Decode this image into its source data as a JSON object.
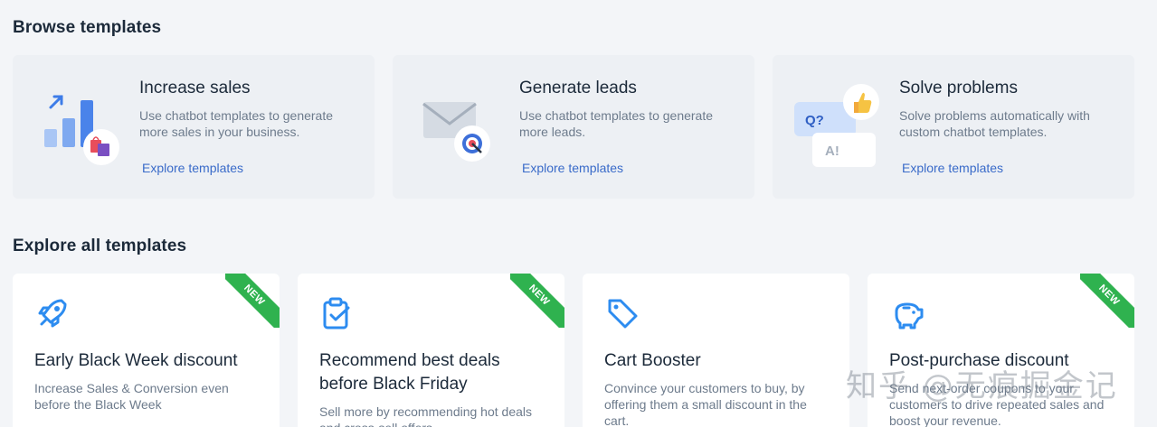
{
  "browse": {
    "title": "Browse templates",
    "cards": [
      {
        "title": "Increase sales",
        "desc": "Use chatbot templates to generate more sales in your business.",
        "link": "Explore templates"
      },
      {
        "title": "Generate leads",
        "desc": "Use chatbot templates to generate more leads.",
        "link": "Explore templates"
      },
      {
        "title": "Solve problems",
        "desc": "Solve problems automatically with custom chatbot templates.",
        "link": "Explore templates",
        "q_label": "Q?",
        "a_label": "A!"
      }
    ]
  },
  "explore": {
    "title": "Explore all templates",
    "badge": "NEW",
    "cards": [
      {
        "title": "Early Black Week discount",
        "desc": "Increase Sales & Conversion even before the Black Week",
        "is_new": true,
        "icon": "rocket-icon"
      },
      {
        "title": "Recommend best deals before Black Friday",
        "desc": "Sell more by recommending hot deals and cross-sell offers",
        "is_new": true,
        "icon": "clipboard-check-icon"
      },
      {
        "title": "Cart Booster",
        "desc": "Convince your customers to buy, by offering them a small discount in the cart.",
        "is_new": false,
        "icon": "tag-icon"
      },
      {
        "title": "Post-purchase discount",
        "desc": "Send next-order coupons to your customers to drive repeated sales and boost your revenue.",
        "is_new": true,
        "icon": "piggy-bank-icon"
      }
    ]
  },
  "watermark": "知乎 @无痕掘金记",
  "colors": {
    "accent": "#3a6bc9",
    "icon_blue": "#2d8cf0",
    "ribbon_green": "#2fb24f",
    "background": "#f3f5f8"
  }
}
